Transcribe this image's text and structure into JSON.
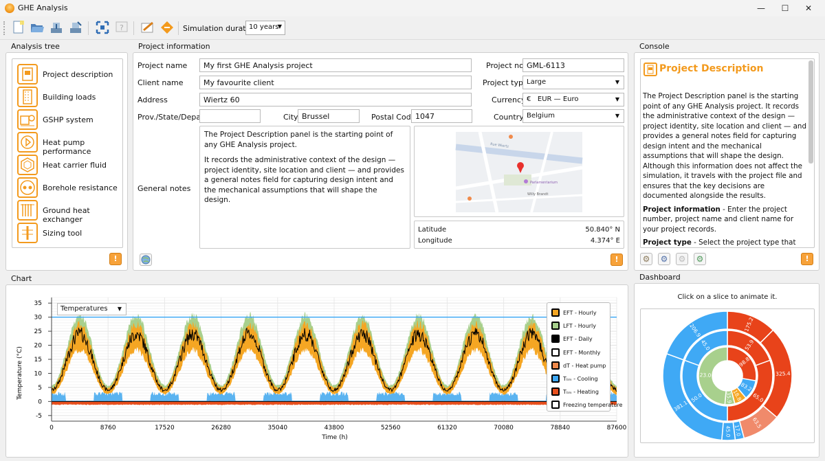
{
  "window": {
    "title": "GHE Analysis",
    "minimize": "—",
    "maximize": "☐",
    "close": "✕"
  },
  "toolbar": {
    "sim_label": "Simulation duration",
    "sim_value": "10 years",
    "icons": [
      "new-file-icon",
      "open-folder-icon",
      "save-icon",
      "save-as-icon",
      "fit-screen-icon",
      "help-icon",
      "edit-notes-icon",
      "export-icon"
    ]
  },
  "analysis_tree": {
    "header": "Analysis tree",
    "items": [
      {
        "label": "Project description",
        "icon": "project-description-icon"
      },
      {
        "label": "Building loads",
        "icon": "building-icon"
      },
      {
        "label": "GSHP system",
        "icon": "gshp-icon"
      },
      {
        "label": "Heat pump performance",
        "icon": "heat-pump-icon"
      },
      {
        "label": "Heat carrier fluid",
        "icon": "fluid-icon"
      },
      {
        "label": "Borehole resistance",
        "icon": "borehole-icon"
      },
      {
        "label": "Ground heat exchanger",
        "icon": "ground-exchanger-icon"
      },
      {
        "label": "Sizing tool",
        "icon": "sizing-icon"
      }
    ]
  },
  "project_info": {
    "header": "Project information",
    "project_name_label": "Project name",
    "project_name": "My first GHE Analysis project",
    "client_name_label": "Client name",
    "client_name": "My favourite client",
    "address_label": "Address",
    "address": "Wiertz 60",
    "prov_label": "Prov./State/Depart.",
    "prov": "",
    "city_label": "City",
    "city": "Brussel",
    "postal_label": "Postal Code",
    "postal": "1047",
    "general_notes_label": "General notes",
    "general_notes_p1": "The Project Description panel is the starting point of any GHE Analysis project.",
    "general_notes_p2": "It records the administrative context of the design — project identity, site location and client — and provides a general notes field for capturing design intent and the mechanical assumptions that will shape the design.",
    "project_no_label": "Project no.",
    "project_no": "GML-6113",
    "project_type_label": "Project type",
    "project_type": "Large",
    "currency_label": "Currency",
    "currency_symbol": "€",
    "currency": "EUR — Euro",
    "country_label": "Country",
    "country": "Belgium",
    "latitude_label": "Latitude",
    "latitude": "50.840° N",
    "longitude_label": "Longitude",
    "longitude": "4.374° E",
    "map_labels": {
      "street1": "Rue Wiertz",
      "poi1": "Parlamentarium",
      "poi2": "Willy Brandt"
    }
  },
  "console": {
    "header": "Console",
    "title": "Project Description",
    "intro": "The Project Description panel is the starting point of any GHE Analysis project. It records the administrative context of the design — project identity, site location and client — and provides a general notes field for capturing design intent and the mechanical assumptions that will shape the design. Although this information does not affect the simulation, it travels with the project file and ensures that the key decisions are documented alongside the results.",
    "p2_bold": "Project information",
    "p2": " - Enter the project number, project name and client name for your project records.",
    "p3_bold": "Project type",
    "p3": " - Select the project type that matches the scale of your design:"
  },
  "chart_panel": {
    "header": "Chart",
    "selector": "Temperatures",
    "legend": [
      {
        "label": "EFT - Hourly",
        "color": "#f5a623"
      },
      {
        "label": "LFT - Hourly",
        "color": "#a8d08d"
      },
      {
        "label": "EFT - Daily",
        "color": "#000000"
      },
      {
        "label": "EFT - Monthly",
        "color": "#ffffff"
      },
      {
        "label": "dT - Heat pump",
        "color": "#f08a4b"
      },
      {
        "label": "Tₗᵢₘ - Cooling",
        "color": "#3fa9f5"
      },
      {
        "label": "Tₗᵢₘ - Heating",
        "color": "#e8501e"
      },
      {
        "label": "Freezing temperature",
        "color": "#ffffff"
      }
    ]
  },
  "chart_data": {
    "type": "line",
    "xlabel": "Time (h)",
    "ylabel": "Temperature (°C)",
    "xlim": [
      0,
      87600
    ],
    "ylim": [
      -7,
      37
    ],
    "x_ticks": [
      0,
      8760,
      17520,
      26280,
      35040,
      43800,
      52560,
      61320,
      70080,
      78840,
      87600
    ],
    "y_ticks": [
      -5,
      0,
      5,
      10,
      15,
      20,
      25,
      30,
      35
    ],
    "cooling_limit": 30,
    "heating_limit": -0.5,
    "freezing": 0,
    "series": [
      {
        "name": "EFT - Daily",
        "x_peak_hours": [
          4380,
          13140,
          21900,
          30660,
          39420,
          48180,
          56940,
          65700,
          74460,
          83220
        ],
        "peak": 24,
        "trough": 3
      },
      {
        "name": "EFT - Hourly",
        "peak": 27,
        "trough": 0.5
      },
      {
        "name": "LFT - Hourly",
        "peak": 31,
        "trough": 2
      }
    ]
  },
  "dashboard": {
    "header": "Dashboard",
    "hint": "Click on a slice to animate it.",
    "rings": {
      "outer": [
        {
          "label": "175.2",
          "color": "#e8431a",
          "value": 175.2
        },
        {
          "label": "325.4",
          "color": "#e8431a",
          "value": 325.4
        },
        {
          "label": "63.5",
          "color": "#f08a6b",
          "value": 63.5
        },
        {
          "label": "17.0",
          "color": "#3fa9f5",
          "value": 17.0
        },
        {
          "label": "45.0",
          "color": "#3fa9f5",
          "value": 45.0
        },
        {
          "label": "381.1",
          "color": "#3fa9f5",
          "value": 381.1
        },
        {
          "label": "206.9",
          "color": "#3fa9f5",
          "value": 206.9
        }
      ],
      "middle": [
        {
          "label": "53.9",
          "color": "#e8431a"
        },
        {
          "label": "65.0",
          "color": "#e8431a"
        },
        {
          "label": "50.0",
          "color": "#3fa9f5"
        },
        {
          "label": "45.0",
          "color": "#3fa9f5"
        }
      ],
      "inner": [
        {
          "label": "98.8",
          "color": "#e8431a"
        },
        {
          "label": "83.2",
          "color": "#3fa9f5"
        },
        {
          "label": "18.8",
          "color": "#f5a623"
        },
        {
          "label": "35.9",
          "color": "#a8d08d"
        },
        {
          "label": "23.0",
          "color": "#a8d08d"
        }
      ]
    }
  }
}
